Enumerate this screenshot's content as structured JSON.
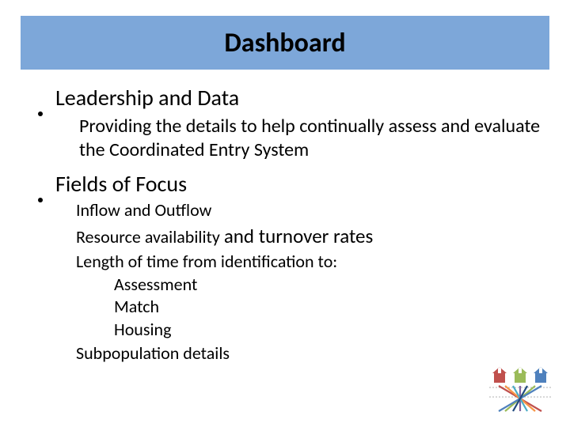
{
  "title": "Dashboard",
  "bullets": [
    {
      "heading": "Leadership and Data",
      "description": "Providing the details to help continually assess and evaluate the Coordinated Entry System"
    },
    {
      "heading": "Fields of Focus",
      "lines": {
        "l1": "Inflow and Outflow",
        "l2a": "Resource availability ",
        "l2b": "and turnover rates",
        "l3": "Length of time from identification to:",
        "l3a": "Assessment",
        "l3b": "Match",
        "l3c": "Housing",
        "l4": "Subpopulation details"
      }
    }
  ],
  "logo": {
    "house_colors": [
      "#C0504D",
      "#9BBB59",
      "#4F81BD"
    ],
    "name": "coordinated-entry-logo"
  }
}
